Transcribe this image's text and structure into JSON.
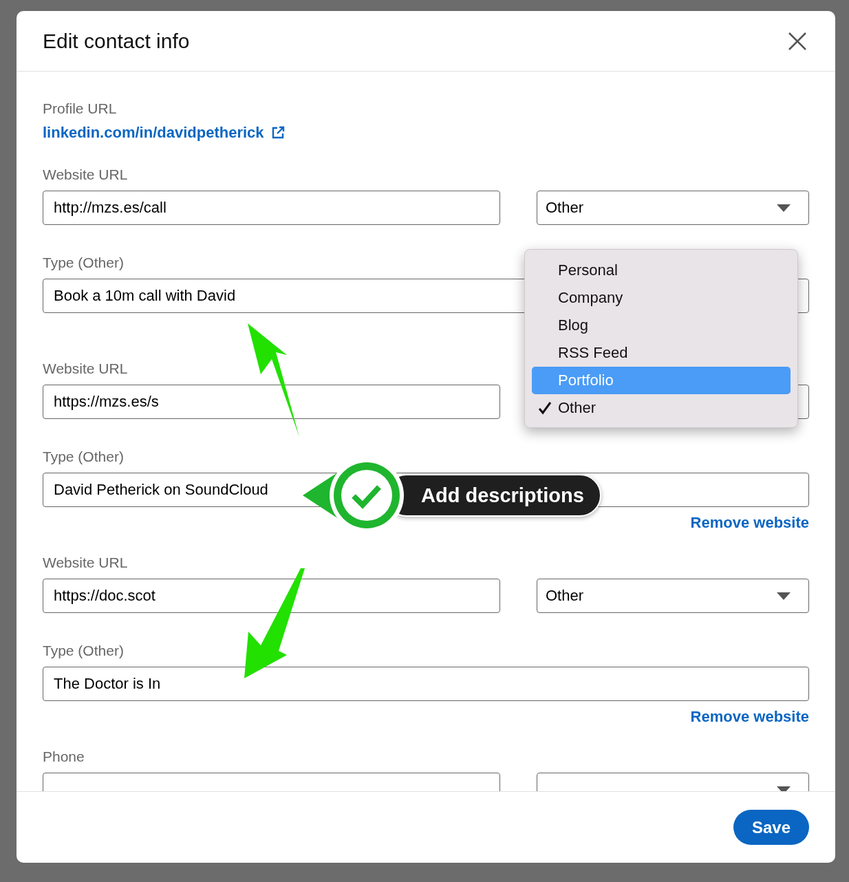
{
  "dialog": {
    "title": "Edit contact info"
  },
  "profile": {
    "label": "Profile URL",
    "link": "linkedin.com/in/davidpetherick"
  },
  "websites": [
    {
      "url_label": "Website URL",
      "url": "http://mzs.es/call",
      "type": "Other",
      "type_label": "Type (Other)",
      "description": "Book a 10m call with David"
    },
    {
      "url_label": "Website URL",
      "url": "https://mzs.es/s",
      "type_label": "Type (Other)",
      "description": "David Petherick on SoundCloud",
      "remove": "Remove website"
    },
    {
      "url_label": "Website URL",
      "url": "https://doc.scot",
      "type": "Other",
      "type_label": "Type (Other)",
      "description": "The Doctor is In",
      "remove": "Remove website"
    }
  ],
  "phone": {
    "label": "Phone"
  },
  "dropdown": {
    "options": [
      {
        "label": "Personal",
        "selected": false,
        "checked": false
      },
      {
        "label": "Company",
        "selected": false,
        "checked": false
      },
      {
        "label": "Blog",
        "selected": false,
        "checked": false
      },
      {
        "label": "RSS Feed",
        "selected": false,
        "checked": false
      },
      {
        "label": "Portfolio",
        "selected": true,
        "checked": false
      },
      {
        "label": "Other",
        "selected": false,
        "checked": true
      }
    ]
  },
  "callout": {
    "text": "Add descriptions"
  },
  "footer": {
    "save": "Save"
  }
}
